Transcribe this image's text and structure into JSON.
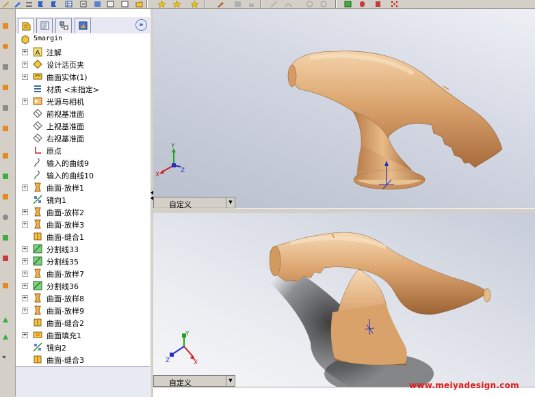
{
  "feature_tree": {
    "root": "5margin",
    "items": [
      {
        "label": "注解",
        "icon": "annotation-icon",
        "expand": "+"
      },
      {
        "label": "设计活页夹",
        "icon": "design-binder-icon",
        "expand": "+"
      },
      {
        "label": "曲面实体(1)",
        "icon": "surface-bodies-icon",
        "expand": "+"
      },
      {
        "label": "材质 <未指定>",
        "icon": "material-icon",
        "expand": ""
      },
      {
        "label": "光源与相机",
        "icon": "lights-cameras-icon",
        "expand": "+"
      },
      {
        "label": "前视基准面",
        "icon": "plane-icon",
        "expand": ""
      },
      {
        "label": "上视基准面",
        "icon": "plane-icon",
        "expand": ""
      },
      {
        "label": "右视基准面",
        "icon": "plane-icon",
        "expand": ""
      },
      {
        "label": "原点",
        "icon": "origin-icon",
        "expand": ""
      },
      {
        "label": "输入的曲线9",
        "icon": "curve-icon",
        "expand": ""
      },
      {
        "label": "输入的曲线10",
        "icon": "curve-icon",
        "expand": ""
      },
      {
        "label": "曲面-放样1",
        "icon": "loft-surface-icon",
        "expand": "+"
      },
      {
        "label": "镜向1",
        "icon": "mirror-icon",
        "expand": ""
      },
      {
        "label": "曲面-放样2",
        "icon": "loft-surface-icon",
        "expand": "+"
      },
      {
        "label": "曲面-放样3",
        "icon": "loft-surface-icon",
        "expand": "+"
      },
      {
        "label": "曲面-缝合1",
        "icon": "knit-surface-icon",
        "expand": ""
      },
      {
        "label": "分割线33",
        "icon": "split-line-icon",
        "expand": "+"
      },
      {
        "label": "分割线35",
        "icon": "split-line-icon",
        "expand": "+"
      },
      {
        "label": "曲面-放样7",
        "icon": "loft-surface-icon",
        "expand": "+"
      },
      {
        "label": "分割线36",
        "icon": "split-line-icon",
        "expand": "+"
      },
      {
        "label": "曲面-放样8",
        "icon": "loft-surface-icon",
        "expand": "+"
      },
      {
        "label": "曲面-放样9",
        "icon": "loft-surface-icon",
        "expand": "+"
      },
      {
        "label": "曲面-缝合2",
        "icon": "knit-surface-icon",
        "expand": ""
      },
      {
        "label": "曲面填充1",
        "icon": "fill-surface-icon",
        "expand": "+"
      },
      {
        "label": "镜向2",
        "icon": "mirror-icon",
        "expand": ""
      },
      {
        "label": "曲面-缝合3",
        "icon": "knit-surface-icon",
        "expand": ""
      }
    ],
    "tabs": [
      "feature-manager-tab",
      "property-manager-tab",
      "configuration-manager-tab",
      "display-manager-tab"
    ],
    "expand_symbol": "»"
  },
  "viewports": {
    "top": {
      "view_label": "自定义",
      "triad": {
        "x": "X",
        "y": "Y",
        "z": "Z"
      }
    },
    "bottom": {
      "view_label": "自定义",
      "triad": {
        "x": "X",
        "y": "Y",
        "z": "Z"
      }
    }
  },
  "watermark": "www.meiyadesign.com",
  "colors": {
    "model": "#d9a06a",
    "model_highlight": "#f3d3aa",
    "model_shadow": "#a86b3c",
    "watermark": "#e11b1b",
    "triad_x": "#d02020",
    "triad_y": "#20a020",
    "triad_z": "#2030c0"
  }
}
